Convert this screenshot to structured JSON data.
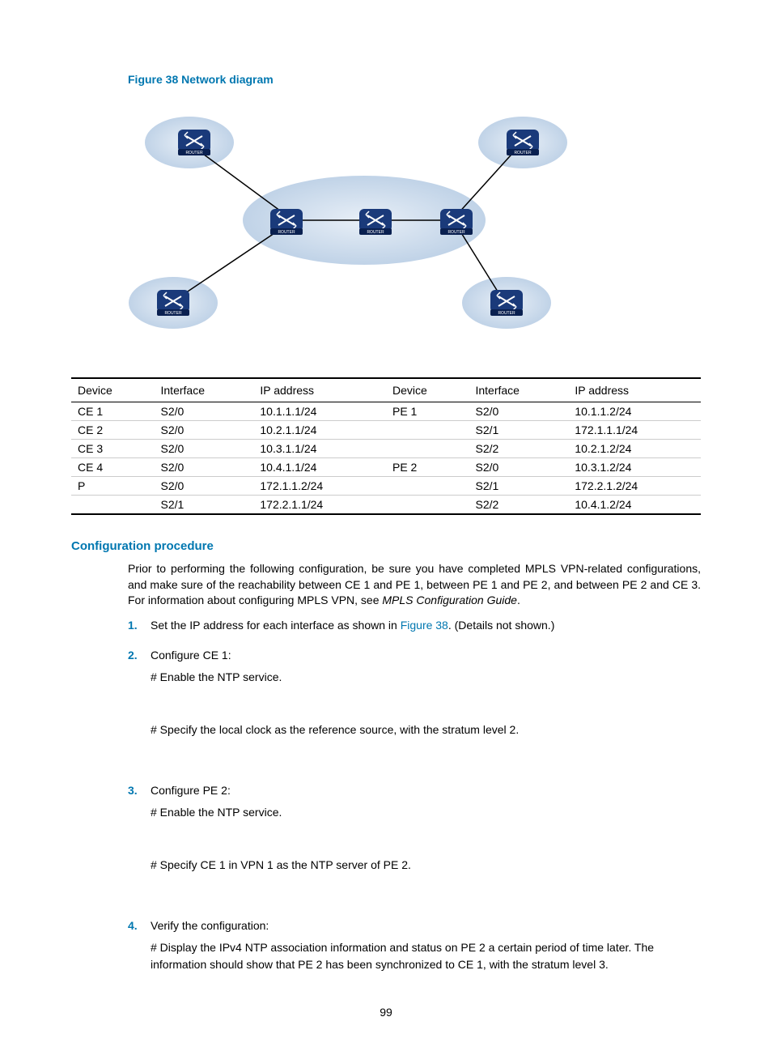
{
  "figure_title": "Figure 38 Network diagram",
  "router_label": "ROUTER",
  "table": {
    "headers": [
      "Device",
      "Interface",
      "IP address",
      "Device",
      "Interface",
      "IP address"
    ],
    "rows": [
      [
        "CE 1",
        "S2/0",
        "10.1.1.1/24",
        "PE 1",
        "S2/0",
        "10.1.1.2/24"
      ],
      [
        "CE 2",
        "S2/0",
        "10.2.1.1/24",
        "",
        "S2/1",
        "172.1.1.1/24"
      ],
      [
        "CE 3",
        "S2/0",
        "10.3.1.1/24",
        "",
        "S2/2",
        "10.2.1.2/24"
      ],
      [
        "CE 4",
        "S2/0",
        "10.4.1.1/24",
        "PE 2",
        "S2/0",
        "10.3.1.2/24"
      ],
      [
        "P",
        "S2/0",
        "172.1.1.2/24",
        "",
        "S2/1",
        "172.2.1.2/24"
      ],
      [
        "",
        "S2/1",
        "172.2.1.1/24",
        "",
        "S2/2",
        "10.4.1.2/24"
      ]
    ]
  },
  "section_heading": "Configuration procedure",
  "intro_para_1": "Prior to performing the following configuration, be sure you have completed MPLS VPN-related configurations, and make sure of the reachability between CE 1 and PE 1, between PE 1 and PE 2, and between PE 2 and CE 3. For information about configuring MPLS VPN, see ",
  "intro_para_italic": "MPLS Configuration Guide",
  "intro_para_tail": ".",
  "steps": {
    "s1_pre": "Set the IP address for each interface as shown in ",
    "s1_ref": "Figure 38",
    "s1_post": ". (Details not shown.)",
    "s2_head": "Configure CE 1:",
    "s2_a": "# Enable the NTP service.",
    "s2_b": "# Specify the local clock as the reference source, with the stratum level 2.",
    "s3_head": "Configure PE 2:",
    "s3_a": "# Enable the NTP service.",
    "s3_b": "# Specify CE 1 in VPN 1 as the NTP server of PE 2.",
    "s4_head": "Verify the configuration:",
    "s4_a": "# Display the IPv4 NTP association information and status on PE 2 a certain period of time later. The information should show that PE 2 has been synchronized to CE 1, with the stratum level 3."
  },
  "page_number": "99"
}
